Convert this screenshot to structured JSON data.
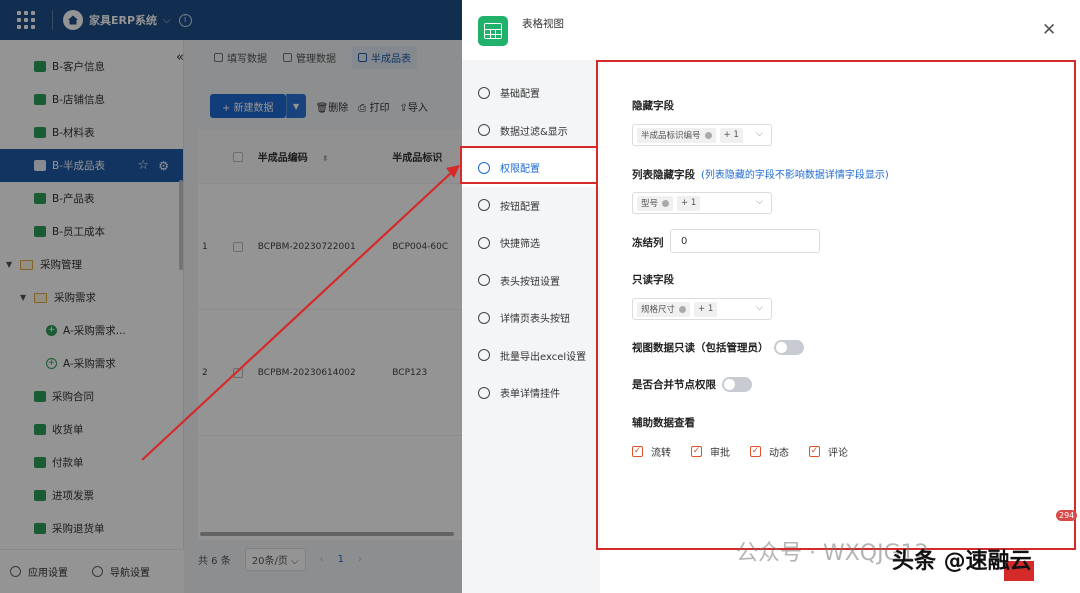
{
  "topbar": {
    "app_name": "家具ERP系统"
  },
  "sidebar": {
    "items": [
      {
        "label": "B-客户信息",
        "level": "l1"
      },
      {
        "label": "B-店铺信息",
        "level": "l1"
      },
      {
        "label": "B-材料表",
        "level": "l1"
      },
      {
        "label": "B-半成品表",
        "level": "l1",
        "active": true
      },
      {
        "label": "B-产品表",
        "level": "l1"
      },
      {
        "label": "B-员工成本",
        "level": "l1"
      },
      {
        "label": "采购管理",
        "level": "l0"
      },
      {
        "label": "采购需求",
        "level": "l2"
      },
      {
        "label": "A-采购需求...",
        "level": "l3"
      },
      {
        "label": "A-采购需求",
        "level": "l3"
      },
      {
        "label": "采购合同",
        "level": "l1"
      },
      {
        "label": "收货单",
        "level": "l1"
      },
      {
        "label": "付款单",
        "level": "l1"
      },
      {
        "label": "进项发票",
        "level": "l1"
      },
      {
        "label": "采购退货单",
        "level": "l1"
      }
    ],
    "bottom": {
      "app_settings": "应用设置",
      "nav_settings": "导航设置"
    }
  },
  "main": {
    "tabs": [
      "填写数据",
      "管理数据",
      "半成品表"
    ],
    "toolbar": {
      "new": "+ 新建数据",
      "delete": "删除",
      "print": "打印",
      "import": "导入"
    },
    "table": {
      "headers": {
        "code": "半成品编码",
        "id": "半成品标识"
      },
      "rows": [
        {
          "idx": "1",
          "code": "BCPBM-20230722001",
          "id": "BCP004-60C"
        },
        {
          "idx": "2",
          "code": "BCPBM-20230614002",
          "id": "BCP123"
        }
      ]
    },
    "pager": {
      "total": "共 6 条",
      "page_size": "20条/页",
      "current": "1"
    }
  },
  "drawer": {
    "title": "表格视图",
    "nav": [
      "基础配置",
      "数据过滤&显示",
      "权限配置",
      "按钮配置",
      "快捷筛选",
      "表头按钮设置",
      "详情页表头按钮",
      "批量导出excel设置",
      "表单详情挂件"
    ],
    "active_nav": 2,
    "fields": {
      "hidden_fields": {
        "label": "隐藏字段",
        "tag": "半成品标识编号",
        "more": "+ 1"
      },
      "list_hidden": {
        "label": "列表隐藏字段",
        "note": "(列表隐藏的字段不影响数据详情字段显示)",
        "tag": "型号",
        "more": "+ 1"
      },
      "freeze": {
        "label": "冻结列",
        "value": "0"
      },
      "readonly": {
        "label": "只读字段",
        "tag": "规格尺寸",
        "more": "+ 1"
      },
      "view_readonly": {
        "label": "视图数据只读（包括管理员）"
      },
      "merge_perm": {
        "label": "是否合并节点权限"
      },
      "aux_view": {
        "label": "辅助数据查看",
        "options": [
          "流转",
          "审批",
          "动态",
          "评论"
        ]
      }
    }
  },
  "overlay": {
    "badge": "294",
    "watermark_wechat": "公众号 · WXQJG12",
    "watermark_toutiao": "头条 @速融云"
  },
  "colors": {
    "accent": "#1e6ad2",
    "sidebar_active": "#1e5aa8",
    "highlight": "#d42a2a",
    "sheet_green": "#20b26b"
  }
}
